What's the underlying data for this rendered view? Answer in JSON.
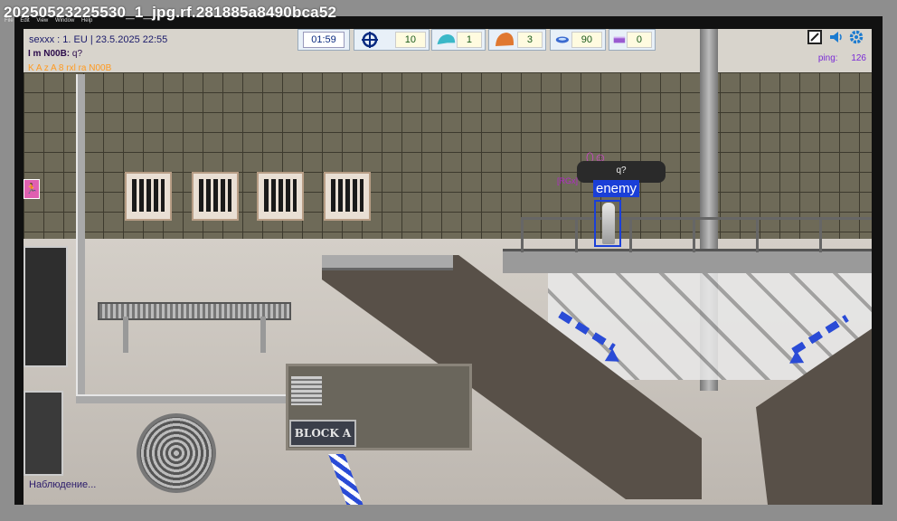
{
  "window": {
    "title": "20250523225530_1_jpg.rf.281885a8490bca52",
    "menu": [
      "File",
      "Edit",
      "View",
      "Window",
      "Help"
    ]
  },
  "hud": {
    "server_line": "sexxx : 1. EU | 23.5.2025 22:55",
    "chat": [
      {
        "author": "I m N00B:",
        "text": "q?"
      },
      {
        "text": "K A z A 8 rxl ra N00B"
      }
    ],
    "timer": "01:59",
    "stats": [
      {
        "icon": "crosshair-icon",
        "value": "10"
      },
      {
        "icon": "helmet-icon",
        "value": "1"
      },
      {
        "icon": "armor-icon",
        "value": "3"
      },
      {
        "icon": "ammo-icon",
        "value": "90"
      },
      {
        "icon": "grenade-icon",
        "value": "0"
      }
    ],
    "ping_label": "ping:",
    "ping_value": "126",
    "status_text": "Наблюдение..."
  },
  "scene": {
    "sign_text": "BLOCK A",
    "enemy_label": "enemy",
    "speech_bubble": "q?",
    "player_tag": "[RGx]"
  },
  "colors": {
    "enemy_box": "#1a3fd8",
    "arrow": "#2a4bd6",
    "hud_bg": "#e8f0f8"
  }
}
